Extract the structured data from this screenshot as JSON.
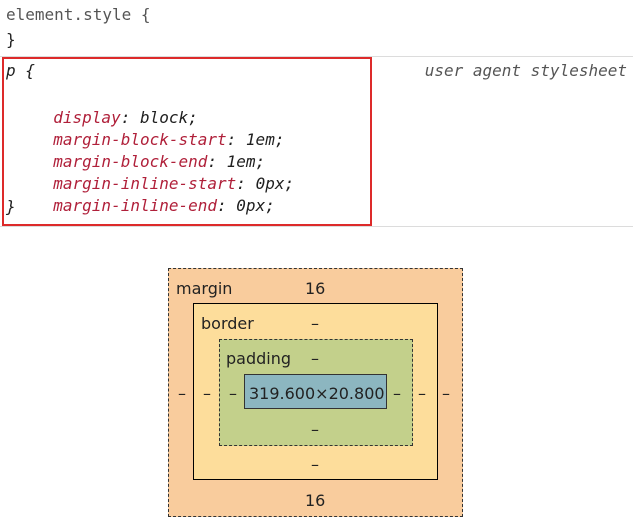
{
  "element_style": {
    "selector": "element.style {",
    "close": "}"
  },
  "ua_rule": {
    "selector": "p {",
    "source": "user agent stylesheet",
    "close": "}",
    "declarations": [
      {
        "prop": "display",
        "value": "block;"
      },
      {
        "prop": "margin-block-start",
        "value": "1em;"
      },
      {
        "prop": "margin-block-end",
        "value": "1em;"
      },
      {
        "prop": "margin-inline-start",
        "value": "0px;"
      },
      {
        "prop": "margin-inline-end",
        "value": "0px;"
      }
    ]
  },
  "box_model": {
    "margin_label": "margin",
    "margin_top": "16",
    "margin_bottom": "16",
    "margin_left": "–",
    "margin_right": "–",
    "border_label": "border",
    "border_top": "–",
    "border_bottom": "–",
    "border_left": "–",
    "border_right": "–",
    "padding_label": "padding",
    "padding_top": "–",
    "padding_bottom": "–",
    "padding_left": "–",
    "padding_right": "–",
    "content_size": "319.600×20.800"
  },
  "colors": {
    "highlight": "#dd2a2a",
    "property": "#b0203a",
    "margin": "#f9cc9d",
    "border": "#fddd9b",
    "padding": "#c3d08b",
    "content": "#8cb6c0"
  }
}
